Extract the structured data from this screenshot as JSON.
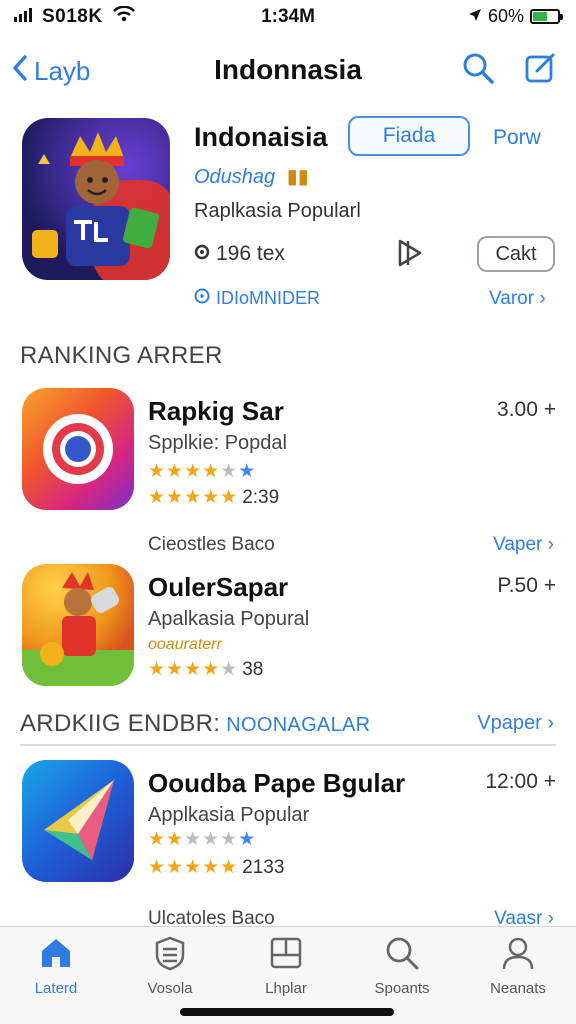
{
  "status": {
    "carrier": "S018K",
    "time": "1:34M",
    "battery": "60%"
  },
  "nav": {
    "back": "Layb",
    "title": "Indonnasia"
  },
  "hero": {
    "title": "Indonaisia",
    "button": "Fiada",
    "link": "Porw",
    "developer": "Odushag",
    "category": "Raplkasia Popularl",
    "size": "196 tex",
    "small_button": "Cakt",
    "info": "IDIoMNIDER",
    "more": "Varor"
  },
  "section1": {
    "title": "RANKING ARRER"
  },
  "apps1": [
    {
      "title": "Rapkig Sar",
      "subtitle": "Spplkie: Popdal",
      "price": "3.00 +",
      "rating_count": "2:39"
    },
    {
      "meta": "Cieostles Baco",
      "meta_more": "Vaper",
      "title": "OulerSapar",
      "subtitle": "Apalkasia Popural",
      "extra": "ooauraterr",
      "price": "P.50 +",
      "rating_count": "38"
    }
  ],
  "section2": {
    "title": "ARDKIIG ENDBR:",
    "accent": "NOONAGALAR",
    "more": "Vpaper"
  },
  "apps2": [
    {
      "title": "Ooudba Pape Bgular",
      "subtitle": "Applkasia Popular",
      "price": "12:00 +",
      "rating_count": "2133",
      "meta": "Ulcatoles Baco",
      "meta_more": "Vaasr"
    }
  ],
  "tabs": [
    {
      "label": "Laterd",
      "icon": "home-icon"
    },
    {
      "label": "Vosola",
      "icon": "games-icon"
    },
    {
      "label": "Lhplar",
      "icon": "apps-icon"
    },
    {
      "label": "Spoants",
      "icon": "search-icon"
    },
    {
      "label": "Neanats",
      "icon": "profile-icon"
    }
  ],
  "colors": {
    "accent": "#2f7de1",
    "star": "#f3a417"
  }
}
